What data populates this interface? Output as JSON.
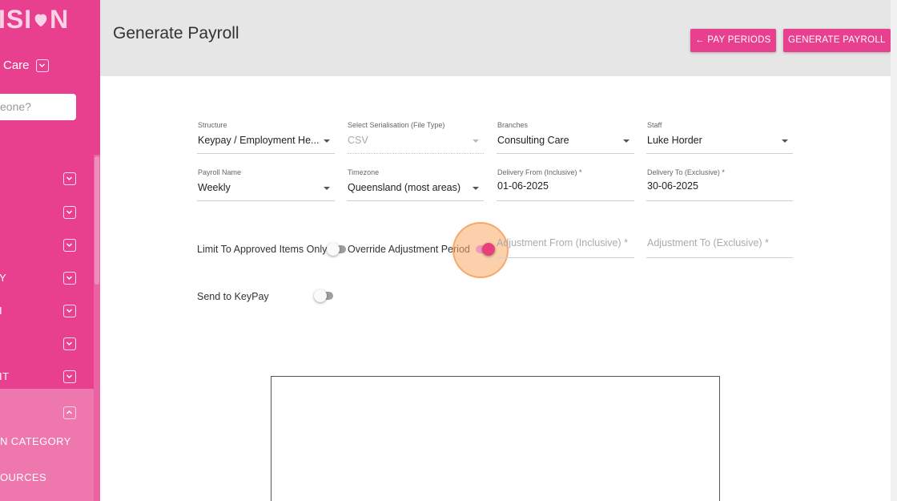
{
  "sidebar": {
    "logo": "ISI",
    "logo_suffix": "N",
    "org": "Care",
    "search_placeholder": "eone?",
    "nav_items": [
      {
        "label": ""
      },
      {
        "label": ""
      },
      {
        "label": ""
      },
      {
        "label": "Y"
      },
      {
        "label": "I"
      },
      {
        "label": ""
      },
      {
        "label": "IT"
      },
      {
        "label": ""
      }
    ],
    "sub_items": [
      {
        "label": "N CATEGORY"
      },
      {
        "label": "OURCES"
      }
    ]
  },
  "header": {
    "title": "Generate Payroll",
    "pay_periods_button": "← PAY PERIODS",
    "generate_button": "GENERATE PAYROLL"
  },
  "form": {
    "structure": {
      "label": "Structure",
      "value": "Keypay / Employment He..."
    },
    "serialisation": {
      "label": "Select Serialisation (File Type)",
      "value": "CSV"
    },
    "branches": {
      "label": "Branches",
      "value": "Consulting Care"
    },
    "staff": {
      "label": "Staff",
      "value": "Luke Horder"
    },
    "payroll_name": {
      "label": "Payroll Name",
      "value": "Weekly"
    },
    "timezone": {
      "label": "Timezone",
      "value": "Queensland (most areas)"
    },
    "delivery_from": {
      "label": "Delivery From (Inclusive) *",
      "value": "01-06-2025"
    },
    "delivery_to": {
      "label": "Delivery To (Exclusive) *",
      "value": "30-06-2025"
    },
    "limit_approved": {
      "label": "Limit To Approved Items Only",
      "on": false
    },
    "override_adjustment": {
      "label": "Override Adjustment Period",
      "on": true
    },
    "adjustment_from": {
      "placeholder": "Adjustment From (Inclusive) *"
    },
    "adjustment_to": {
      "placeholder": "Adjustment To (Exclusive) *"
    },
    "send_keypay": {
      "label": "Send to KeyPay",
      "on": false
    }
  },
  "colors": {
    "brand": "#e8408f",
    "header_bg": "#e6e6e6",
    "toggle_on": "#e8407a"
  }
}
